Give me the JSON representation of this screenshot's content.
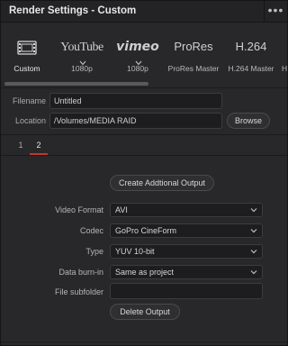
{
  "window": {
    "title": "Render Settings - Custom",
    "more_glyph": "•••"
  },
  "presets": [
    {
      "name": "custom",
      "logo_kind": "film-icon",
      "label": "Custom",
      "selected": true
    },
    {
      "name": "youtube",
      "logo_text": "YouTube",
      "label": "1080p",
      "has_chevron": true
    },
    {
      "name": "vimeo",
      "logo_text": "vimeo",
      "label": "1080p",
      "has_chevron": true
    },
    {
      "name": "prores",
      "logo_text": "ProRes",
      "label": "ProRes Master"
    },
    {
      "name": "h264",
      "logo_text": "H.264",
      "label": "H.264 Master"
    },
    {
      "name": "partial",
      "logo_text": "",
      "label": "H"
    }
  ],
  "file": {
    "filename_label": "Filename",
    "filename_value": "Untitled",
    "location_label": "Location",
    "location_value": "/Volumes/MEDIA RAID",
    "browse_label": "Browse"
  },
  "tabs": [
    {
      "label": "1",
      "active": false
    },
    {
      "label": "2",
      "active": true
    }
  ],
  "output": {
    "create_button": "Create Addtional Output",
    "fields": [
      {
        "label": "Video Format",
        "value": "AVI",
        "type": "select"
      },
      {
        "label": "Codec",
        "value": "GoPro CineForm",
        "type": "select"
      },
      {
        "label": "Type",
        "value": "YUV 10-bit",
        "type": "select"
      },
      {
        "label": "Data burn-in",
        "value": "Same as project",
        "type": "select"
      },
      {
        "label": "File subfolder",
        "value": "",
        "type": "text"
      }
    ],
    "delete_button": "Delete Output"
  },
  "colors": {
    "accent_tab_underline": "#c0392b",
    "background": "#28282a"
  }
}
